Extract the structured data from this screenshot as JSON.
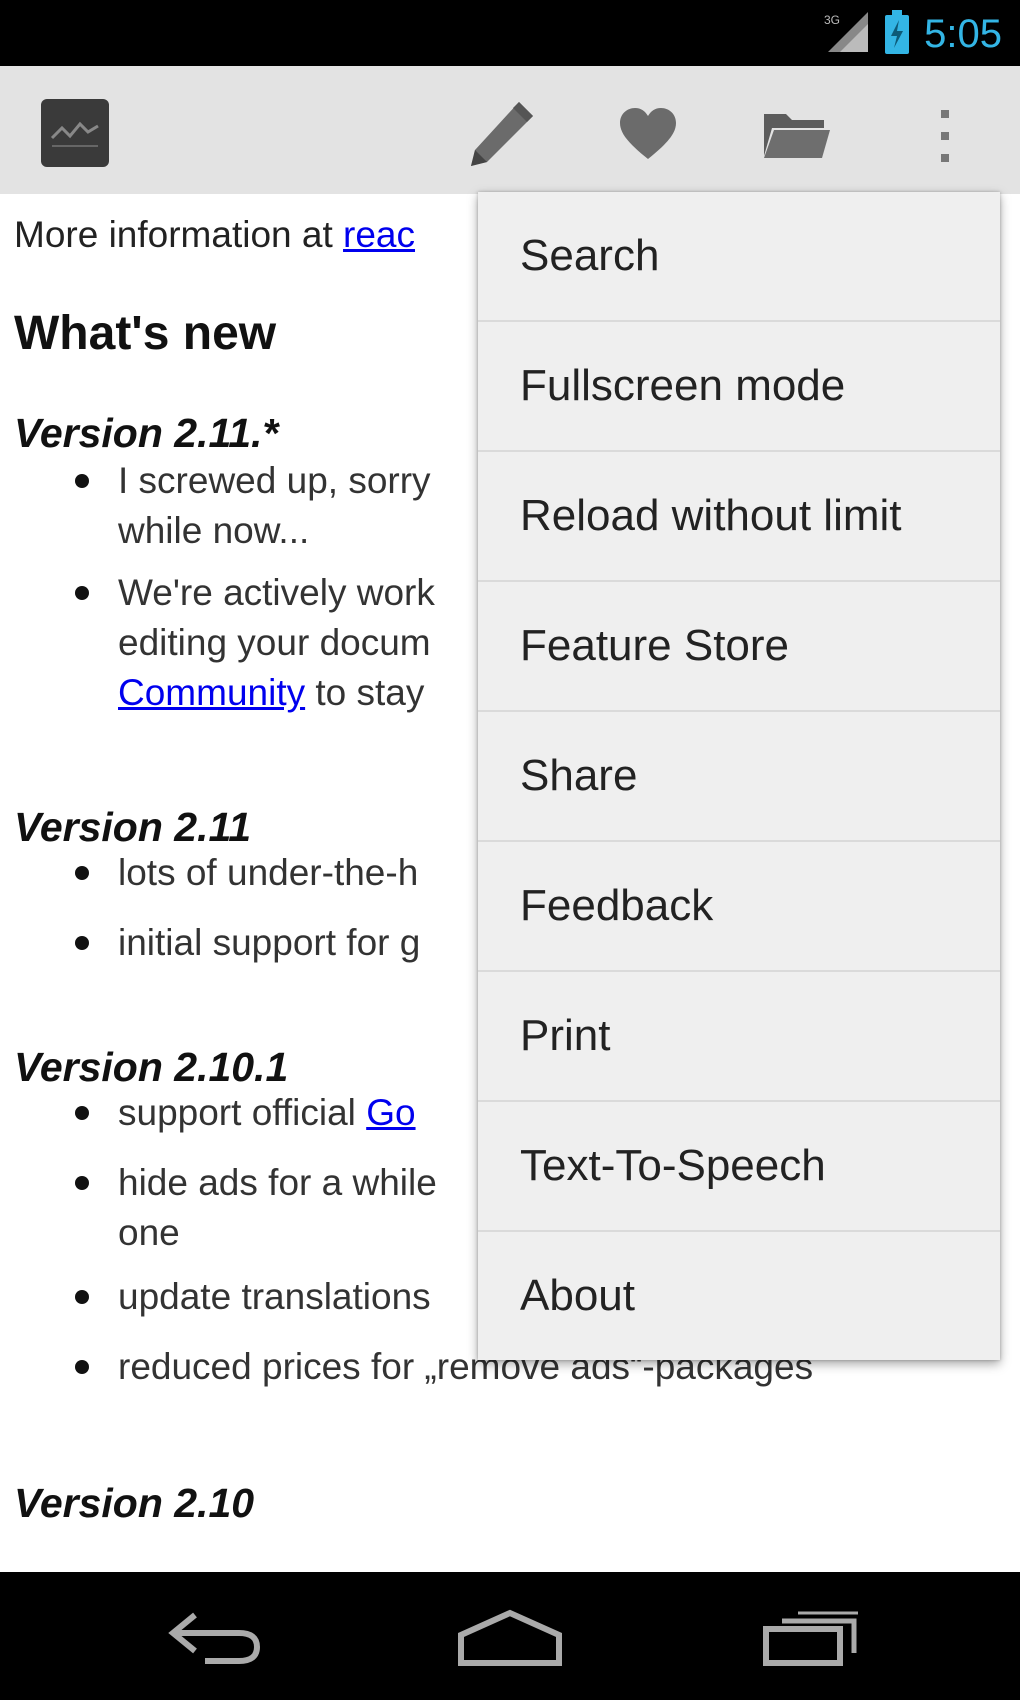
{
  "status_bar": {
    "network_label": "3G",
    "time": "5:05",
    "time_color": "#33b5e5"
  },
  "action_bar": {
    "background": "#e3e3e3",
    "app_icon": "document-icon",
    "actions": [
      {
        "icon": "pencil-icon"
      },
      {
        "icon": "heart-icon"
      },
      {
        "icon": "folder-icon"
      },
      {
        "icon": "overflow-menu-icon"
      }
    ]
  },
  "content": {
    "intro_prefix": "More information at ",
    "intro_link": "reac",
    "heading": "What's new",
    "sections": [
      {
        "title": "Version 2.11.*",
        "items": [
          {
            "lines": [
              "I screwed up, sorry",
              "while now..."
            ]
          },
          {
            "lines": [
              "We're actively work",
              "editing your docum"
            ],
            "link": "Community",
            "link_suffix": " to stay"
          }
        ]
      },
      {
        "title": "Version 2.11",
        "items": [
          {
            "lines": [
              "lots of under-the-h"
            ]
          },
          {
            "lines": [
              "initial support for g"
            ]
          }
        ]
      },
      {
        "title": "Version 2.10.1",
        "items": [
          {
            "prefix": "support official ",
            "link": "Go"
          },
          {
            "lines": [
              "hide ads for a while",
              "one"
            ]
          },
          {
            "lines": [
              "update translations"
            ]
          },
          {
            "lines": [
              "reduced prices for „remove ads“-packages"
            ]
          }
        ]
      },
      {
        "title": "Version 2.10",
        "items": []
      }
    ]
  },
  "overflow_menu": {
    "items": [
      "Search",
      "Fullscreen mode",
      "Reload without limit",
      "Feature Store",
      "Share",
      "Feedback",
      "Print",
      "Text-To-Speech",
      "About"
    ]
  },
  "nav_bar": {
    "buttons": [
      "back-icon",
      "home-icon",
      "recent-apps-icon"
    ]
  }
}
